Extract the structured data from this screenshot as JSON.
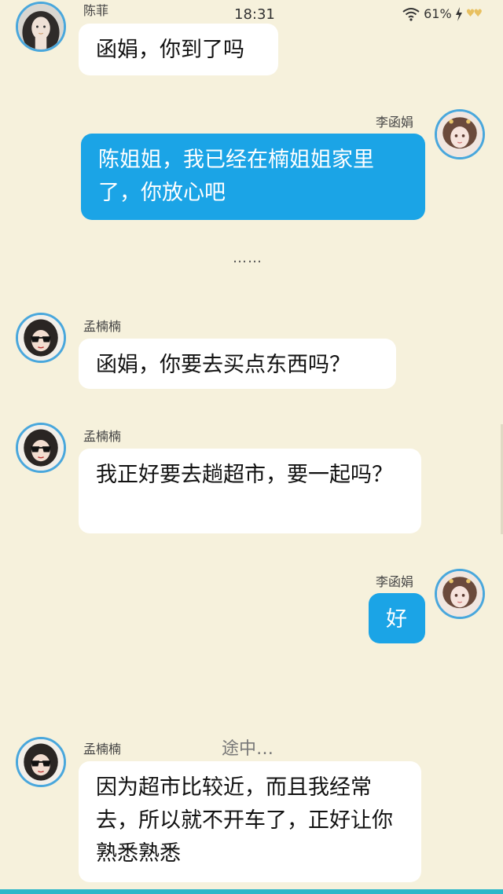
{
  "status_bar": {
    "time": "18:31",
    "battery": "61%"
  },
  "messages": [
    {
      "sender": "陈菲",
      "text": "函娟，你到了吗",
      "side": "left",
      "avatar": "chen-fei-avatar"
    },
    {
      "sender": "李函娟",
      "text": "陈姐姐，我已经在楠姐姐家里了，你放心吧",
      "side": "right",
      "avatar": "li-hanjuan-avatar"
    },
    {
      "sender": "孟楠楠",
      "text": "函娟，你要去买点东西吗？",
      "side": "left",
      "avatar": "meng-nannan-avatar"
    },
    {
      "sender": "孟楠楠",
      "text": "我正好要去趟超市，要一起吗？",
      "side": "left",
      "avatar": "meng-nannan-avatar"
    },
    {
      "sender": "李函娟",
      "text": "好",
      "side": "right",
      "avatar": "li-hanjuan-avatar"
    },
    {
      "sender": "孟楠楠",
      "text": "因为超市比较近，而且我经常去，所以就不开车了，正好让你熟悉熟悉",
      "side": "left",
      "avatar": "meng-nannan-avatar"
    }
  ],
  "ellipsis": "……",
  "scene_note": "途中…",
  "colors": {
    "background": "#f6f1dc",
    "outgoing_bubble": "#1ba4e6",
    "incoming_bubble": "#ffffff",
    "avatar_ring": "#49a7dc"
  }
}
